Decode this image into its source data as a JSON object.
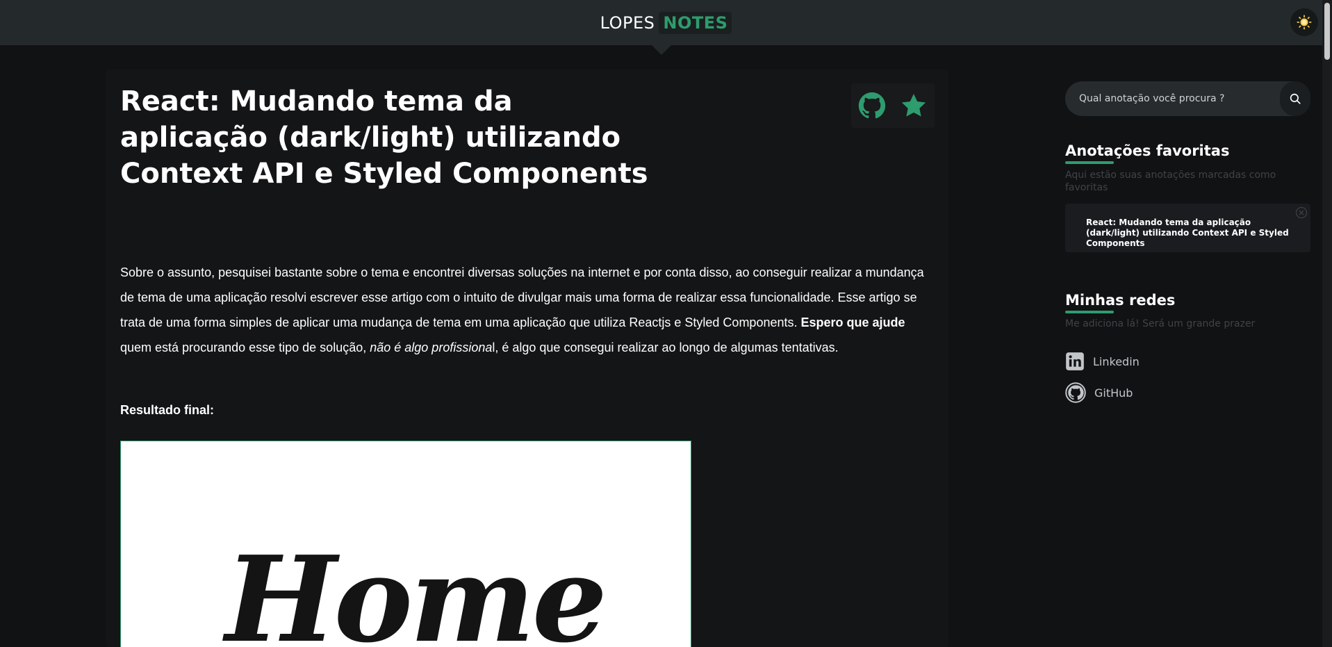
{
  "header": {
    "logo_left": "LOPES",
    "logo_right": "NOTES",
    "theme_icon": "sun-icon"
  },
  "article": {
    "title": "React: Mudando tema da aplicação (dark/light) utilizando Context API e Styled Components",
    "actions": [
      {
        "name": "github-icon"
      },
      {
        "name": "star-icon"
      }
    ],
    "body": {
      "p1": "Sobre o assunto, pesquisei bastante sobre o tema e encontrei diversas soluções na internet e por conta disso, ao conseguir realizar a mundança de tema de uma aplicação resolvi escrever esse artigo com o intuito de divulgar mais uma forma de realizar essa funcionalidade. Esse artigo se trata de uma forma simples de aplicar uma mudança de tema em uma aplicação que utiliza Reactjs e Styled Components. ",
      "bold": "Espero que ajude",
      "p2": " quem está procurando esse tipo de solução, ",
      "italic": "não é algo profissiona",
      "p3": "l, é algo que consegui realizar ao longo de algumas tentativas."
    },
    "subhead": "Resultado final:",
    "preview_word": "Home"
  },
  "sidebar": {
    "search": {
      "placeholder": "Qual anotação você procura ?",
      "icon": "search-icon"
    },
    "favorites": {
      "title": "Anotações favoritas",
      "subtitle": "Aqui estão suas anotações marcadas como favoritas",
      "items": [
        {
          "title": "React: Mudando tema da aplicação (dark/light) utilizando Context API e Styled Components"
        }
      ]
    },
    "networks": {
      "title": "Minhas redes",
      "subtitle": "Me adiciona lá! Será um grande prazer",
      "links": [
        {
          "label": "Linkedin",
          "icon": "linkedin-icon"
        },
        {
          "label": "GitHub",
          "icon": "github-icon"
        }
      ]
    }
  },
  "colors": {
    "accent": "#2e9c6e",
    "background": "#111214",
    "header": "#242a2c"
  }
}
